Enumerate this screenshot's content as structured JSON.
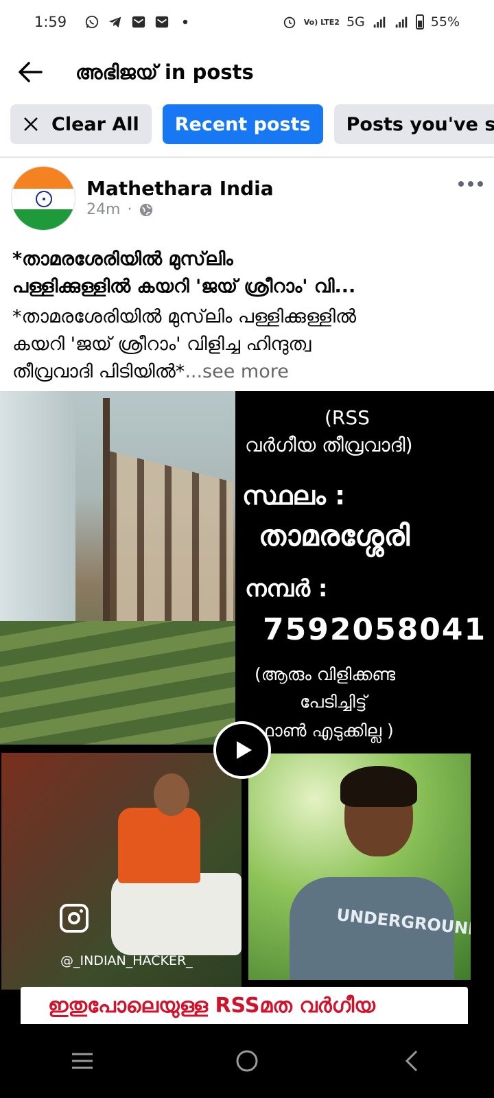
{
  "status_bar": {
    "time": "1:59",
    "left_icons": [
      "whatsapp-icon",
      "telegram-icon",
      "mail-icon",
      "mail-icon",
      "dot-icon"
    ],
    "network_label": "Vo) LTE2",
    "network_type": "5G",
    "battery": "55%"
  },
  "header": {
    "title": "അഭിജയ് in posts",
    "back_icon": "arrow-left-icon"
  },
  "filters": [
    {
      "label": "Clear All",
      "active": false
    },
    {
      "label": "Recent posts",
      "active": true
    },
    {
      "label": "Posts you've seen",
      "active": false
    }
  ],
  "post": {
    "author": "Mathethara India",
    "time": "24m",
    "privacy_icon": "globe-icon",
    "title_line1": "*താമരശേരിയിൽ മുസ്‌ലിം",
    "title_line2": "പള്ളിക്കുള്ളിൽ കയറി 'ജയ് ശ്രീറാം' വി...",
    "body_line1": "*താമരശേരിയിൽ മുസ്‌ലിം പള്ളിക്കുള്ളിൽ",
    "body_line2": "കയറി 'ജയ് ശ്രീറാം' വിളിച്ച ഹിന്ദുത്വ",
    "body_line3": "തീവ്രവാദി പിടിയിൽ*",
    "see_more": "...see more",
    "media": {
      "text_rss": "(RSS",
      "text_extremist": "വർഗീയ തീവ്രവാദി)",
      "text_place_label": "സ്ഥലം :",
      "text_place": "താമരശ്ശേരി",
      "text_number_label": "നമ്പർ :",
      "text_number": "7592058041",
      "text_note1": "(ആരും വിളിക്കണ്ട",
      "text_note2": "പേടിച്ചിട്ട്",
      "text_note3": "ഫോൺ എടുക്കില്ല )",
      "instagram_handle": "@_INDIAN_HACKER_",
      "shirt_text": "UNDERGROUND",
      "banner_text": "ഇതുപോലെയുള്ള RSSമത വർഗീയ"
    }
  },
  "colors": {
    "accent": "#1877f2",
    "chip_bg": "#e4e6eb",
    "muted": "#65676b",
    "banner_red": "#d2112a"
  }
}
